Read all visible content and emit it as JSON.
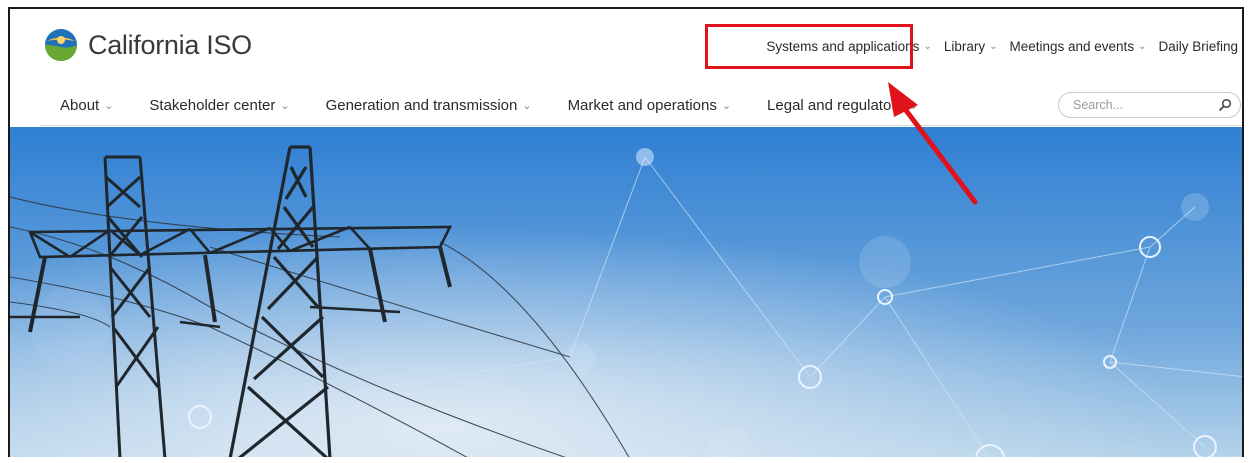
{
  "brand": {
    "name": "California ISO"
  },
  "utility_nav": [
    {
      "label": "Systems and applications",
      "has_menu": true
    },
    {
      "label": "Library",
      "has_menu": true
    },
    {
      "label": "Meetings and events",
      "has_menu": true
    },
    {
      "label": "Daily Briefing",
      "has_menu": false
    }
  ],
  "main_nav": [
    {
      "label": "About"
    },
    {
      "label": "Stakeholder center"
    },
    {
      "label": "Generation and transmission"
    },
    {
      "label": "Market and operations"
    },
    {
      "label": "Legal and regulatory"
    }
  ],
  "search": {
    "placeholder": "Search..."
  },
  "icons": {
    "chevron": "chevron-down-icon",
    "search": "search-icon",
    "logo": "sun-leaf-logo-icon"
  },
  "colors": {
    "annotation": "#e0121b",
    "sky_top": "#2f7fd3",
    "sky_bottom": "#b5d3ea"
  }
}
